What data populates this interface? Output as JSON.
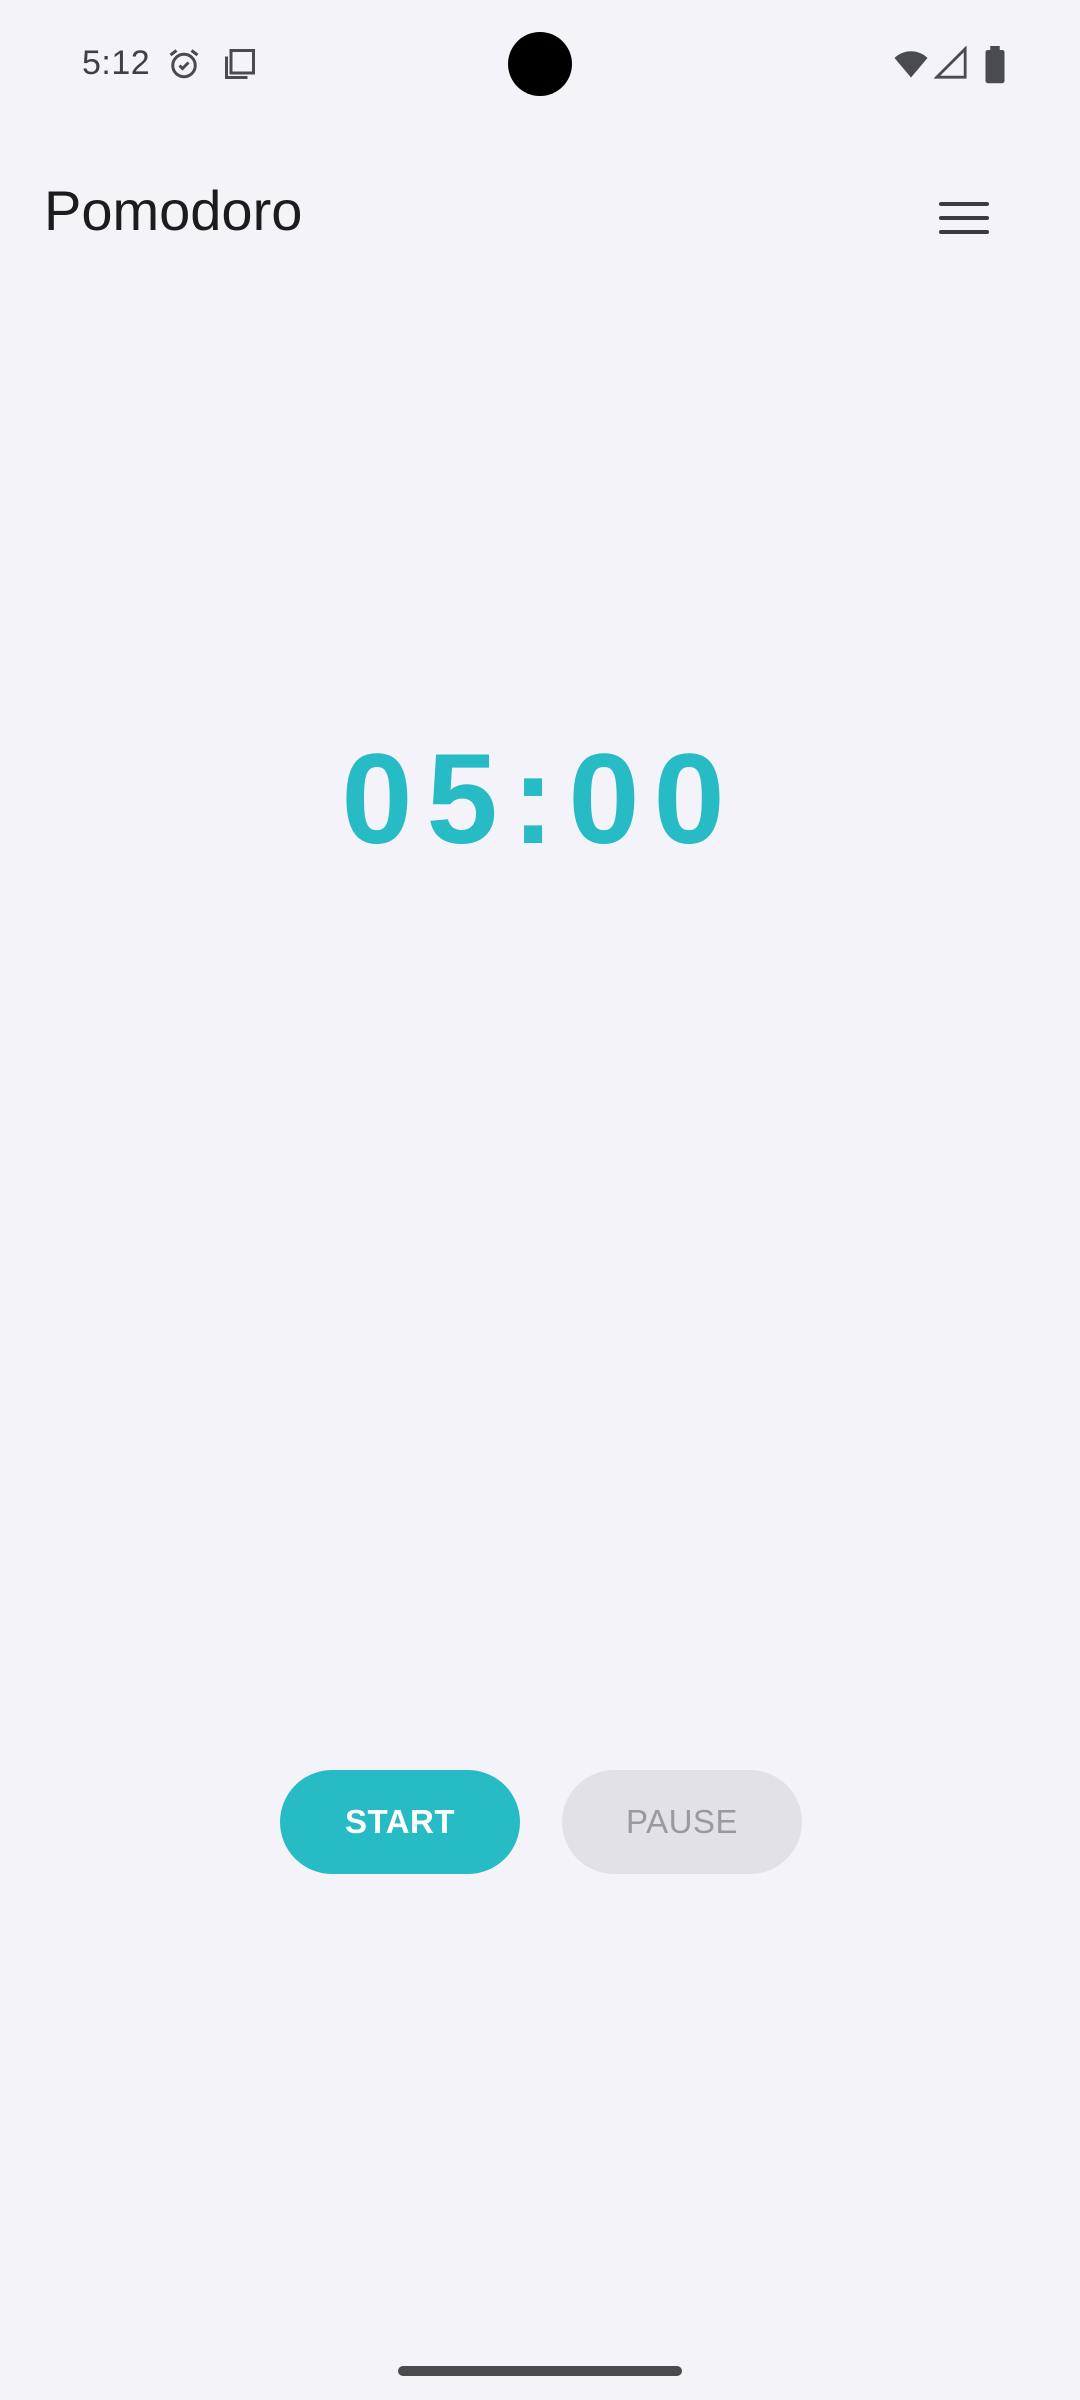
{
  "status_bar": {
    "time": "5:12",
    "icons": [
      "alarm-icon",
      "screenshot-icon",
      "wifi-icon",
      "signal-icon",
      "battery-icon"
    ]
  },
  "app_bar": {
    "title": "Pomodoro",
    "menu_icon": "hamburger-menu-icon"
  },
  "timer": {
    "display": "05:00"
  },
  "controls": {
    "start_label": "START",
    "pause_label": "PAUSE"
  },
  "colors": {
    "accent": "#27bbc6",
    "background": "#f4f3fa",
    "disabled_button": "#e2e1e8",
    "disabled_text": "#9a99a1"
  }
}
